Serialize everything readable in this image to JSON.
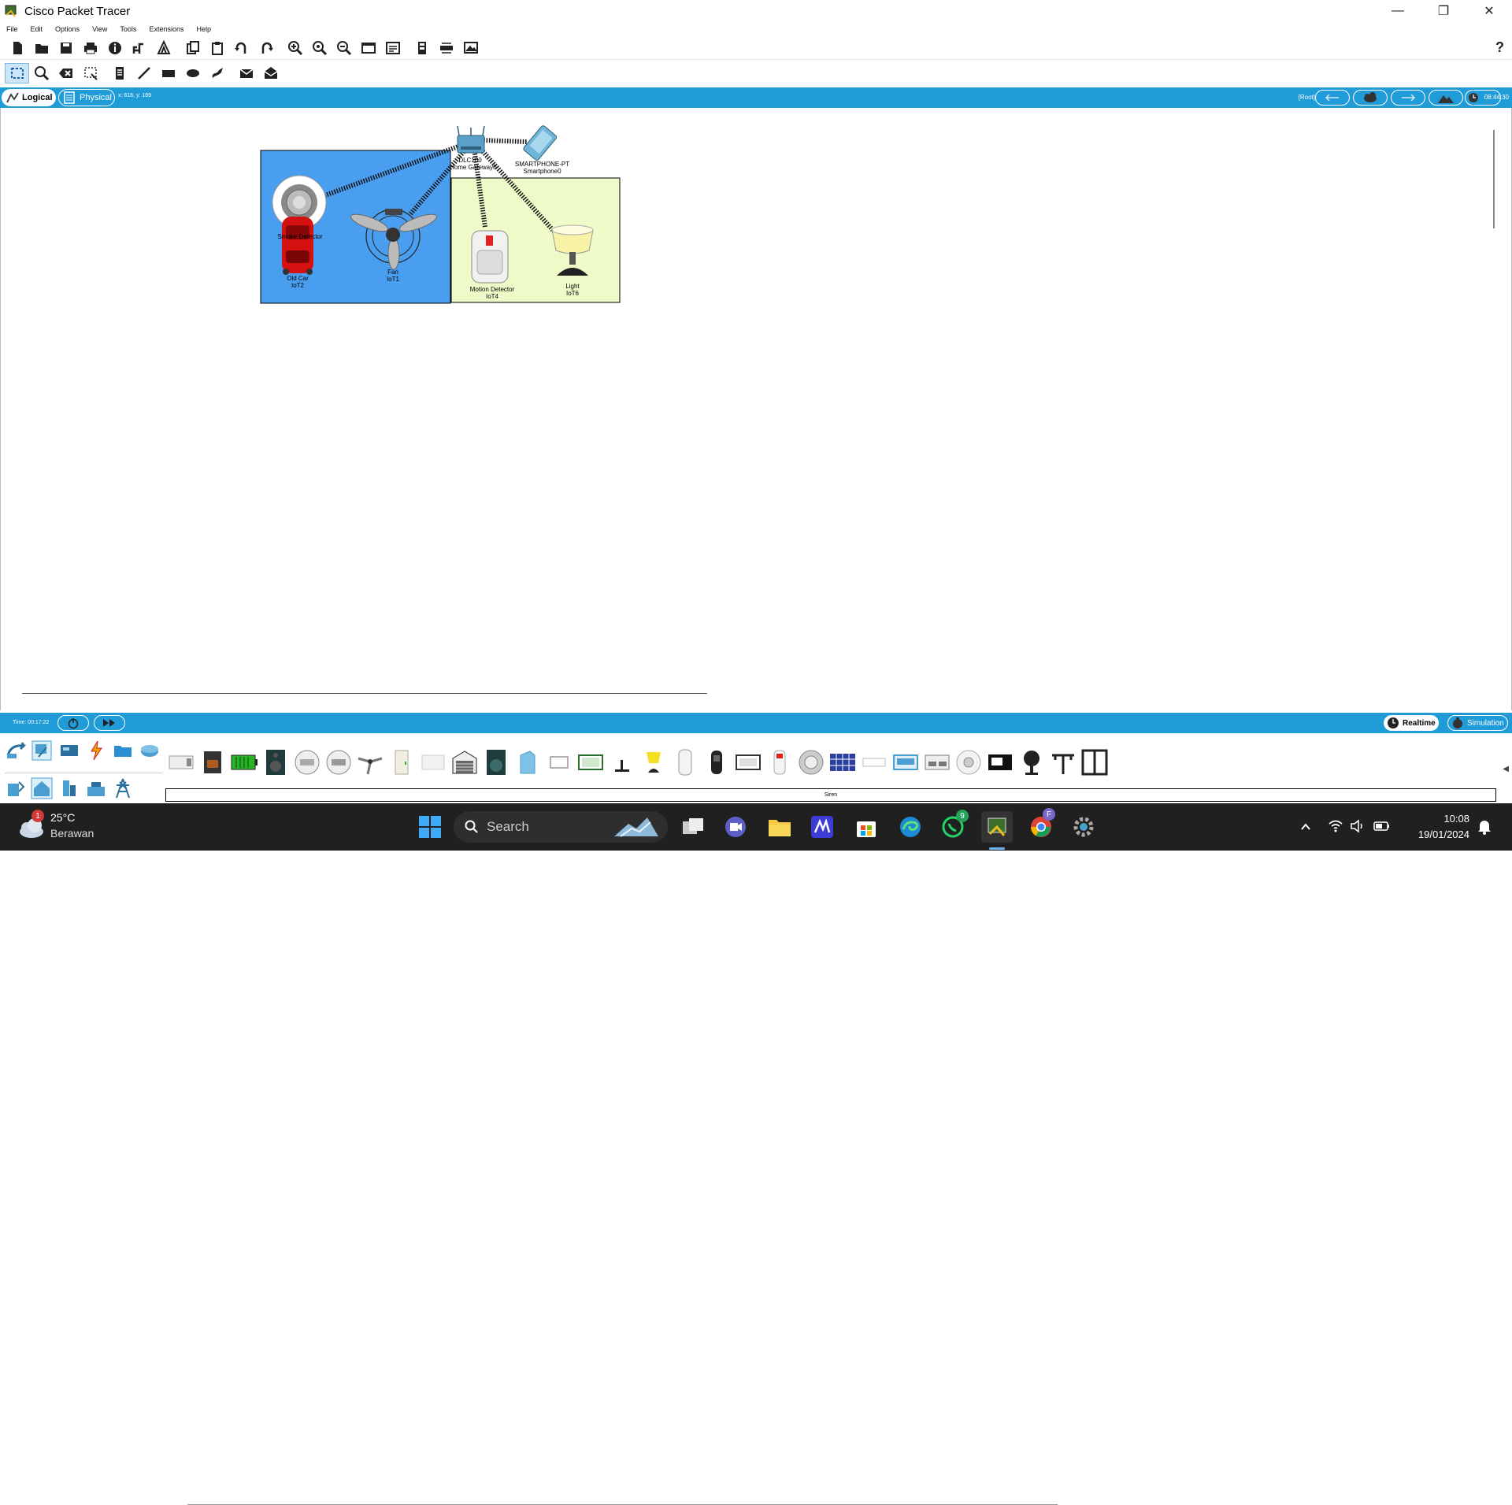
{
  "window": {
    "title": "Cisco Packet Tracer",
    "minimize": "—",
    "restore": "❐",
    "close": "✕"
  },
  "menu": [
    "File",
    "Edit",
    "Options",
    "View",
    "Tools",
    "Extensions",
    "Help"
  ],
  "help_label": "?",
  "workspace_bar": {
    "logical": "Logical",
    "physical": "Physical",
    "coords": "x: 618, y: 189",
    "root": "[Root]",
    "clock": "08:44:30"
  },
  "devices": {
    "gateway": {
      "line1": "DLC100",
      "line2": "Home Gateway0"
    },
    "smartphone": {
      "line1": "SMARTPHONE-PT",
      "line2": "Smartphone0"
    },
    "smoke_detector": {
      "line1": "Smoke Detector"
    },
    "old_car": {
      "line1": "Old Car",
      "line2": "IoT2"
    },
    "fan": {
      "line1": "Fan",
      "line2": "IoT1"
    },
    "motion_detector": {
      "line1": "Motion Detector",
      "line2": "IoT4"
    },
    "light": {
      "line1": "Light",
      "line2": "IoT6"
    }
  },
  "colors": {
    "blue_zone": "#4a9ef0",
    "yellow_zone": "#eefbc8",
    "bar_blue": "#1f9bd7",
    "taskbar": "#202020"
  },
  "bottom_bar": {
    "time": "Time: 00:17:22",
    "realtime": "Realtime",
    "simulation": "Simulation"
  },
  "device_panel": {
    "selected_device": "Siren"
  },
  "taskbar": {
    "temp": "25°C",
    "weather": "Berawan",
    "weather_badge": "1",
    "search": "Search",
    "whatsapp_badge": "9",
    "chrome_badge": "F",
    "time": "10:08",
    "date": "19/01/2024"
  }
}
